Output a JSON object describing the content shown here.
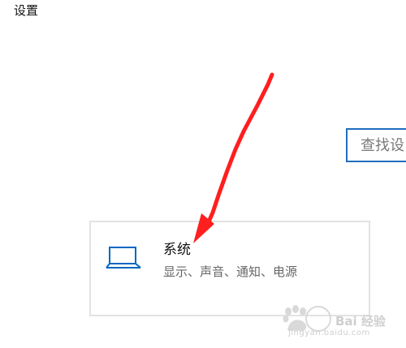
{
  "window": {
    "title": "设置"
  },
  "search": {
    "placeholder": "查找设"
  },
  "system_card": {
    "title": "系统",
    "subtitle": "显示、声音、通知、电源",
    "icon": "laptop-icon",
    "icon_color": "#0067c0"
  },
  "annotation": {
    "color": "#ff1f1f"
  },
  "watermark": {
    "text": "Bai 经验",
    "domain": "jingyan.baidu.com"
  }
}
